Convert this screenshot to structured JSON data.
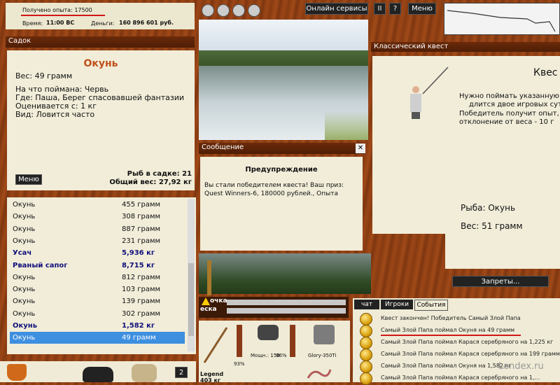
{
  "stats": {
    "exp_label": "Получено опыта: 17500",
    "time_label": "Время:",
    "time_value": "11:00 ВС",
    "money_label": "Деньги:",
    "money_value": "160 896 601 руб."
  },
  "topbar": {
    "online_services": "Онлайн сервисы",
    "pause": "II",
    "help": "?",
    "menu": "Меню"
  },
  "sadok": {
    "header": "Садок",
    "fish_name": "Окунь",
    "weight": "Вес: 49 грамм",
    "bait": "На что поймана: Червь",
    "where": "Где: Паша, Берег спасовавшей фантазии",
    "price": "Оценивается с: 1 кг",
    "kind": "Вид: Ловится часто",
    "menu_btn": "Меню",
    "count": "Рыб в садке: 21",
    "total_weight": "Общий вес: 27,92 кг"
  },
  "fish_list": [
    {
      "name": "Окунь",
      "weight": "455 грамм",
      "bold": false
    },
    {
      "name": "Окунь",
      "weight": "308 грамм",
      "bold": false
    },
    {
      "name": "Окунь",
      "weight": "887 грамм",
      "bold": false
    },
    {
      "name": "Окунь",
      "weight": "231 грамм",
      "bold": false
    },
    {
      "name": "Усач",
      "weight": "5,936 кг",
      "bold": true
    },
    {
      "name": "Рваный сапог",
      "weight": "8,715 кг",
      "bold": true
    },
    {
      "name": "Окунь",
      "weight": "812 грамм",
      "bold": false
    },
    {
      "name": "Окунь",
      "weight": "103 грамм",
      "bold": false
    },
    {
      "name": "Окунь",
      "weight": "139 грамм",
      "bold": false
    },
    {
      "name": "Окунь",
      "weight": "302 грамм",
      "bold": false
    },
    {
      "name": "Окунь",
      "weight": "1,582 кг",
      "bold": true
    },
    {
      "name": "Окунь",
      "weight": "49 грамм",
      "bold": false,
      "selected": true
    }
  ],
  "message": {
    "header": "Сообщение",
    "close": "✕",
    "title": "Предупреждение",
    "text": "Вы стали победителем квеста! Ваш приз: Quest Winners-6, 180000 рублей., Опыта"
  },
  "quest": {
    "header": "Классический квест",
    "title": "Квес",
    "line1": "Нужно поймать указанную",
    "line2": "длится двое игровых суток",
    "line3": "Победитель получит опыт,",
    "line4": "отклонение от веса - 10 г",
    "fish": "Рыба: Окунь",
    "weight": "Вес: 51 грамм"
  },
  "bans_btn": "Запреты...",
  "tackle": {
    "line1": "очка",
    "line2": "еска"
  },
  "inventory": {
    "rod_name": "Legend",
    "rod_weight": "403 кг",
    "rod_pct": "93%",
    "reel_label": "Мощн.: 150",
    "reel_pct": "96%",
    "line_name": "Glory-350Ti"
  },
  "chat": {
    "tabs": [
      "чат",
      "Игроки",
      "События"
    ],
    "active_tab": 2,
    "feed": [
      "Квест закончен! Победитель Самый Злой Папа",
      "Самый Злой Папа поймал Окуня на 49 грамм",
      "Самый Злой Папа поймал Карася серебряного на 1,225 кг",
      "Самый Злой Папа поймал Карася серебряного на 199 грамм",
      "Самый Злой Папа поймал Окуня на 1,582 кг",
      "Самый Злой Папа поймал Карася серебряного на 1,..."
    ]
  },
  "bottom": {
    "badge": "2"
  },
  "watermark": "Lendex.ru",
  "colors": {
    "accent_red": "#d01818",
    "fish_title": "#c0501a",
    "selection": "#3d8fe0"
  }
}
